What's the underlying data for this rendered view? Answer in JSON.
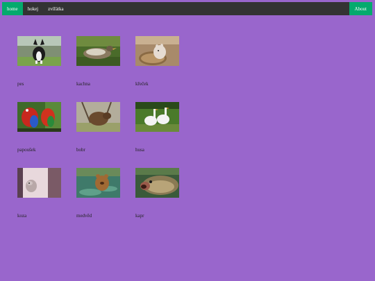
{
  "nav": {
    "items": [
      {
        "label": "home",
        "active": true
      },
      {
        "label": "hokej",
        "active": false
      },
      {
        "label": "zvířátka",
        "active": false
      }
    ],
    "about_label": "About"
  },
  "gallery": [
    {
      "caption": "pes",
      "image": "dog-photo"
    },
    {
      "caption": "kachna",
      "image": "duck-photo"
    },
    {
      "caption": "křeček",
      "image": "hamster-photo"
    },
    {
      "caption": "papoušek",
      "image": "parrot-photo"
    },
    {
      "caption": "bobr",
      "image": "beaver-photo"
    },
    {
      "caption": "husa",
      "image": "goose-photo"
    },
    {
      "caption": "koza",
      "image": "goat-photo"
    },
    {
      "caption": "medvěd",
      "image": "bear-photo"
    },
    {
      "caption": "kapr",
      "image": "carp-photo"
    }
  ],
  "colors": {
    "background": "#9966cc",
    "navbar": "#333333",
    "accent": "#04aa6d"
  }
}
